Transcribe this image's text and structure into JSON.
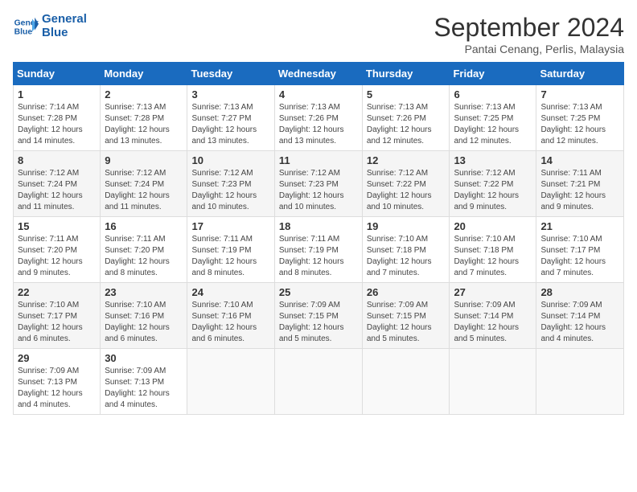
{
  "header": {
    "logo_line1": "General",
    "logo_line2": "Blue",
    "month_title": "September 2024",
    "subtitle": "Pantai Cenang, Perlis, Malaysia"
  },
  "weekdays": [
    "Sunday",
    "Monday",
    "Tuesday",
    "Wednesday",
    "Thursday",
    "Friday",
    "Saturday"
  ],
  "weeks": [
    [
      {
        "day": "1",
        "sunrise": "7:14 AM",
        "sunset": "7:28 PM",
        "daylight": "12 hours and 14 minutes."
      },
      {
        "day": "2",
        "sunrise": "7:13 AM",
        "sunset": "7:28 PM",
        "daylight": "12 hours and 13 minutes."
      },
      {
        "day": "3",
        "sunrise": "7:13 AM",
        "sunset": "7:27 PM",
        "daylight": "12 hours and 13 minutes."
      },
      {
        "day": "4",
        "sunrise": "7:13 AM",
        "sunset": "7:26 PM",
        "daylight": "12 hours and 13 minutes."
      },
      {
        "day": "5",
        "sunrise": "7:13 AM",
        "sunset": "7:26 PM",
        "daylight": "12 hours and 12 minutes."
      },
      {
        "day": "6",
        "sunrise": "7:13 AM",
        "sunset": "7:25 PM",
        "daylight": "12 hours and 12 minutes."
      },
      {
        "day": "7",
        "sunrise": "7:13 AM",
        "sunset": "7:25 PM",
        "daylight": "12 hours and 12 minutes."
      }
    ],
    [
      {
        "day": "8",
        "sunrise": "7:12 AM",
        "sunset": "7:24 PM",
        "daylight": "12 hours and 11 minutes."
      },
      {
        "day": "9",
        "sunrise": "7:12 AM",
        "sunset": "7:24 PM",
        "daylight": "12 hours and 11 minutes."
      },
      {
        "day": "10",
        "sunrise": "7:12 AM",
        "sunset": "7:23 PM",
        "daylight": "12 hours and 10 minutes."
      },
      {
        "day": "11",
        "sunrise": "7:12 AM",
        "sunset": "7:23 PM",
        "daylight": "12 hours and 10 minutes."
      },
      {
        "day": "12",
        "sunrise": "7:12 AM",
        "sunset": "7:22 PM",
        "daylight": "12 hours and 10 minutes."
      },
      {
        "day": "13",
        "sunrise": "7:12 AM",
        "sunset": "7:22 PM",
        "daylight": "12 hours and 9 minutes."
      },
      {
        "day": "14",
        "sunrise": "7:11 AM",
        "sunset": "7:21 PM",
        "daylight": "12 hours and 9 minutes."
      }
    ],
    [
      {
        "day": "15",
        "sunrise": "7:11 AM",
        "sunset": "7:20 PM",
        "daylight": "12 hours and 9 minutes."
      },
      {
        "day": "16",
        "sunrise": "7:11 AM",
        "sunset": "7:20 PM",
        "daylight": "12 hours and 8 minutes."
      },
      {
        "day": "17",
        "sunrise": "7:11 AM",
        "sunset": "7:19 PM",
        "daylight": "12 hours and 8 minutes."
      },
      {
        "day": "18",
        "sunrise": "7:11 AM",
        "sunset": "7:19 PM",
        "daylight": "12 hours and 8 minutes."
      },
      {
        "day": "19",
        "sunrise": "7:10 AM",
        "sunset": "7:18 PM",
        "daylight": "12 hours and 7 minutes."
      },
      {
        "day": "20",
        "sunrise": "7:10 AM",
        "sunset": "7:18 PM",
        "daylight": "12 hours and 7 minutes."
      },
      {
        "day": "21",
        "sunrise": "7:10 AM",
        "sunset": "7:17 PM",
        "daylight": "12 hours and 7 minutes."
      }
    ],
    [
      {
        "day": "22",
        "sunrise": "7:10 AM",
        "sunset": "7:17 PM",
        "daylight": "12 hours and 6 minutes."
      },
      {
        "day": "23",
        "sunrise": "7:10 AM",
        "sunset": "7:16 PM",
        "daylight": "12 hours and 6 minutes."
      },
      {
        "day": "24",
        "sunrise": "7:10 AM",
        "sunset": "7:16 PM",
        "daylight": "12 hours and 6 minutes."
      },
      {
        "day": "25",
        "sunrise": "7:09 AM",
        "sunset": "7:15 PM",
        "daylight": "12 hours and 5 minutes."
      },
      {
        "day": "26",
        "sunrise": "7:09 AM",
        "sunset": "7:15 PM",
        "daylight": "12 hours and 5 minutes."
      },
      {
        "day": "27",
        "sunrise": "7:09 AM",
        "sunset": "7:14 PM",
        "daylight": "12 hours and 5 minutes."
      },
      {
        "day": "28",
        "sunrise": "7:09 AM",
        "sunset": "7:14 PM",
        "daylight": "12 hours and 4 minutes."
      }
    ],
    [
      {
        "day": "29",
        "sunrise": "7:09 AM",
        "sunset": "7:13 PM",
        "daylight": "12 hours and 4 minutes."
      },
      {
        "day": "30",
        "sunrise": "7:09 AM",
        "sunset": "7:13 PM",
        "daylight": "12 hours and 4 minutes."
      },
      null,
      null,
      null,
      null,
      null
    ]
  ]
}
